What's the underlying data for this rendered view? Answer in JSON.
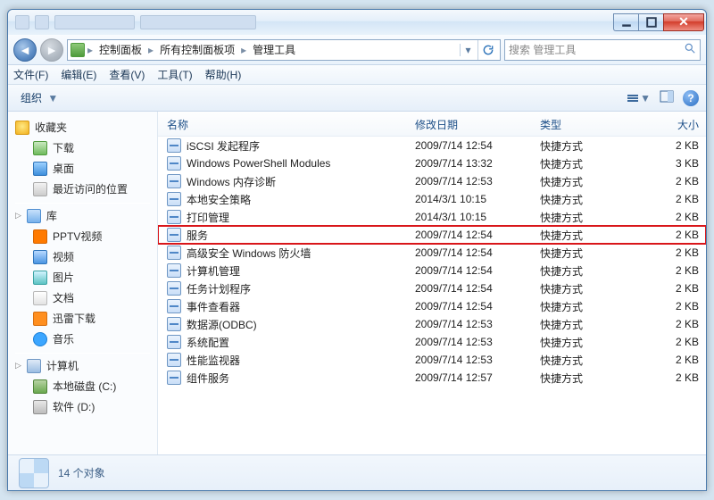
{
  "address": {
    "segments": [
      "控制面板",
      "所有控制面板项",
      "管理工具"
    ],
    "search_placeholder": "搜索 管理工具"
  },
  "menus": {
    "file": "文件(F)",
    "edit": "编辑(E)",
    "view": "查看(V)",
    "tools": "工具(T)",
    "help": "帮助(H)"
  },
  "toolbar": {
    "organize": "组织"
  },
  "sidebar": {
    "favorites": "收藏夹",
    "downloads": "下载",
    "desktop": "桌面",
    "recent": "最近访问的位置",
    "libraries": "库",
    "pptv": "PPTV视频",
    "videos": "视频",
    "pictures": "图片",
    "documents": "文档",
    "xunlei": "迅雷下载",
    "music": "音乐",
    "computer": "计算机",
    "cdrive": "本地磁盘 (C:)",
    "ddrive": "软件 (D:)"
  },
  "columns": {
    "name": "名称",
    "date": "修改日期",
    "type": "类型",
    "size": "大小"
  },
  "files": [
    {
      "name": "iSCSI 发起程序",
      "date": "2009/7/14 12:54",
      "type": "快捷方式",
      "size": "2 KB"
    },
    {
      "name": "Windows PowerShell Modules",
      "date": "2009/7/14 13:32",
      "type": "快捷方式",
      "size": "3 KB"
    },
    {
      "name": "Windows 内存诊断",
      "date": "2009/7/14 12:53",
      "type": "快捷方式",
      "size": "2 KB"
    },
    {
      "name": "本地安全策略",
      "date": "2014/3/1 10:15",
      "type": "快捷方式",
      "size": "2 KB"
    },
    {
      "name": "打印管理",
      "date": "2014/3/1 10:15",
      "type": "快捷方式",
      "size": "2 KB"
    },
    {
      "name": "服务",
      "date": "2009/7/14 12:54",
      "type": "快捷方式",
      "size": "2 KB",
      "highlight": true
    },
    {
      "name": "高级安全 Windows 防火墙",
      "date": "2009/7/14 12:54",
      "type": "快捷方式",
      "size": "2 KB"
    },
    {
      "name": "计算机管理",
      "date": "2009/7/14 12:54",
      "type": "快捷方式",
      "size": "2 KB"
    },
    {
      "name": "任务计划程序",
      "date": "2009/7/14 12:54",
      "type": "快捷方式",
      "size": "2 KB"
    },
    {
      "name": "事件查看器",
      "date": "2009/7/14 12:54",
      "type": "快捷方式",
      "size": "2 KB"
    },
    {
      "name": "数据源(ODBC)",
      "date": "2009/7/14 12:53",
      "type": "快捷方式",
      "size": "2 KB"
    },
    {
      "name": "系统配置",
      "date": "2009/7/14 12:53",
      "type": "快捷方式",
      "size": "2 KB"
    },
    {
      "name": "性能监视器",
      "date": "2009/7/14 12:53",
      "type": "快捷方式",
      "size": "2 KB"
    },
    {
      "name": "组件服务",
      "date": "2009/7/14 12:57",
      "type": "快捷方式",
      "size": "2 KB"
    }
  ],
  "status": {
    "count": "14 个对象"
  }
}
